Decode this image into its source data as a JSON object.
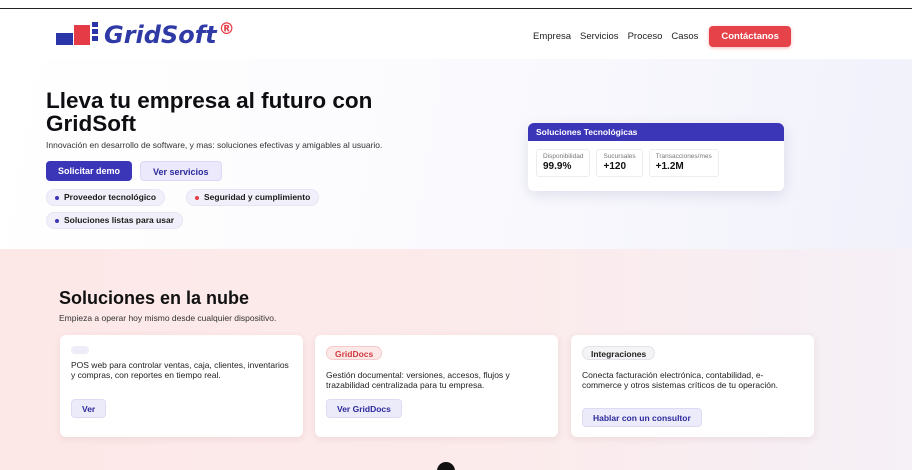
{
  "header": {
    "logo_text": "GridSoft",
    "logo_reg": "®",
    "nav": [
      "Empresa",
      "Servicios",
      "Proceso",
      "Casos"
    ],
    "contact_label": "Contáctanos"
  },
  "hero": {
    "title": "Lleva tu empresa al futuro con GridSoft",
    "subtitle": "Innovación en desarrollo de software, y mas: soluciones efectivas y amigables al usuario.",
    "primary_cta": "Solicitar demo",
    "secondary_cta": "Ver servicios",
    "tags": [
      "Proveedor tecnológico",
      "Seguridad y cumplimiento",
      "Soluciones listas para usar"
    ]
  },
  "stats_card": {
    "title": "Soluciones Tecnológicas",
    "stats": [
      {
        "label": "Disponibilidad",
        "value": "99.9%"
      },
      {
        "label": "Sucursales",
        "value": "+120"
      },
      {
        "label": "Transacciones/mes",
        "value": "+1.2M"
      }
    ]
  },
  "cloud": {
    "title": "Soluciones en la nube",
    "subtitle": "Empieza a operar hoy mismo desde cualquier dispositivo.",
    "cards": [
      {
        "badge": "",
        "desc": "POS web para controlar ventas, caja, clientes, inventarios y compras, con reportes en tiempo real.",
        "cta": "Ver"
      },
      {
        "badge": "GridDocs",
        "desc": "Gestión documental: versiones, accesos, flujos y trazabilidad centralizada para tu empresa.",
        "cta": "Ver GridDocs"
      },
      {
        "badge": "Integraciones",
        "desc": "Conecta facturación electrónica, contabilidad, e-commerce y otros sistemas críticos de tu operación.",
        "cta": "Hablar con un consultor"
      }
    ]
  },
  "colors": {
    "primary": "#3b35b8",
    "accent": "#e54349"
  }
}
